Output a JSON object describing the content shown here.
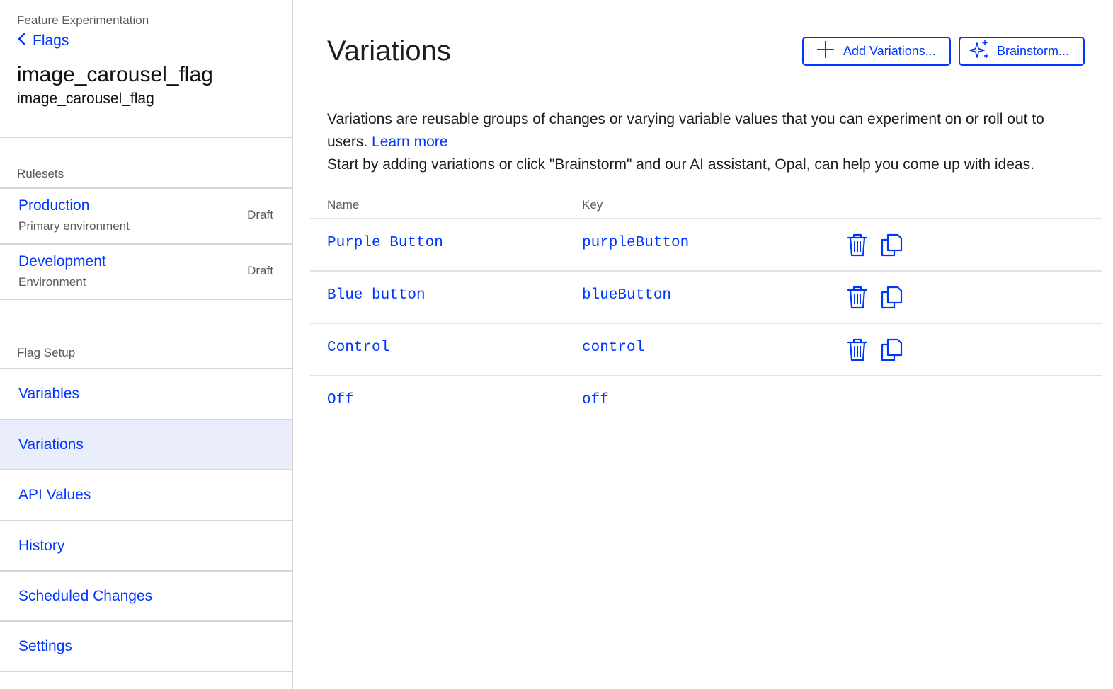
{
  "sidebar": {
    "breadcrumb": "Feature Experimentation",
    "back_link": "Flags",
    "flag_name": "image_carousel_flag",
    "flag_key": "image_carousel_flag",
    "rulesets_label": "Rulesets",
    "rulesets": [
      {
        "name": "Production",
        "sub": "Primary environment",
        "status": "Draft"
      },
      {
        "name": "Development",
        "sub": "Environment",
        "status": "Draft"
      }
    ],
    "setup_label": "Flag Setup",
    "nav": [
      {
        "label": "Variables"
      },
      {
        "label": "Variations"
      },
      {
        "label": "API Values"
      },
      {
        "label": "History"
      },
      {
        "label": "Scheduled Changes"
      },
      {
        "label": "Settings"
      }
    ]
  },
  "main": {
    "title": "Variations",
    "add_button": "Add Variations...",
    "brainstorm_button": "Brainstorm...",
    "description_1": "Variations are reusable groups of changes or varying variable values that you can experiment on or roll out to users.",
    "learn_more": "Learn more",
    "description_2": "Start by adding variations or click \"Brainstorm\" and our AI assistant, Opal, can help you come up with ideas.",
    "table": {
      "headers": {
        "name": "Name",
        "key": "Key"
      },
      "rows": [
        {
          "name": "Purple Button",
          "key": "purpleButton"
        },
        {
          "name": "Blue button",
          "key": "blueButton"
        },
        {
          "name": "Control",
          "key": "control"
        },
        {
          "name": "Off",
          "key": "off"
        }
      ]
    }
  },
  "colors": {
    "accent": "#0037ff",
    "active_bg": "#eaeefc",
    "muted_text": "#5a5a5a",
    "divider": "#d6d6d6"
  },
  "icons": [
    "chevron-left-icon",
    "plus-icon",
    "sparkle-icon",
    "trash-icon",
    "copy-icon"
  ]
}
